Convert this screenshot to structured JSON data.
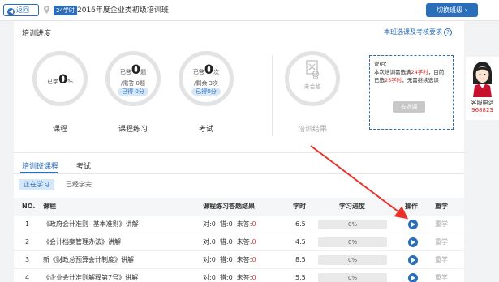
{
  "topbar": {
    "back_label": "返回",
    "hours_badge": "24学时",
    "class_title": "2016年度企业类初级培训班",
    "switch_label": "切换班级"
  },
  "progress": {
    "title": "培训进度",
    "rule_link": "本班选课及考核要求",
    "course": {
      "label": "课程",
      "prefix": "已学",
      "value": "0",
      "unit": "%"
    },
    "practice": {
      "label": "课程练习",
      "prefix": "已答",
      "value": "0",
      "unit": "题",
      "line2": "/需答 0题",
      "pill": "已得 0分"
    },
    "exam": {
      "label": "考试",
      "prefix": "已答",
      "value": "0",
      "unit": "次",
      "line2": "/剩余 3次",
      "pill": "已得0分"
    },
    "result": {
      "label": "培训结果",
      "status": "未合格"
    },
    "note": {
      "title": "说明：",
      "line1_a": "本次培训需选满",
      "line1_b": "24学时",
      "line1_c": "，目前",
      "line2_a": "已选",
      "line2_b": "25学时",
      "line2_c": "，无需继续选课",
      "button": "去选课"
    }
  },
  "tabs": [
    {
      "label": "培训班课程",
      "active": true
    },
    {
      "label": "考试",
      "active": false
    }
  ],
  "subtabs": [
    {
      "label": "正在学习",
      "active": true
    },
    {
      "label": "已经学完",
      "active": false
    }
  ],
  "table": {
    "headers": {
      "no": "NO.",
      "course": "课程",
      "practice": "课程练习答题结果",
      "hours": "学时",
      "progress": "学习进度",
      "action": "操作",
      "restudy": "重学"
    },
    "rows": [
      {
        "no": "1",
        "course": "《政府会计准则--基本准则》讲解",
        "r1": "对:0",
        "r2": "错:0",
        "r3": "未答:",
        "r3v": "0",
        "hours": "6.5",
        "progress": "0%",
        "restudy": "重学"
      },
      {
        "no": "2",
        "course": "《会计档案管理办法》讲解",
        "r1": "对:0",
        "r2": "错:0",
        "r3": "未答:",
        "r3v": "0",
        "hours": "4.5",
        "progress": "0%",
        "restudy": "重学"
      },
      {
        "no": "3",
        "course": "新《财政总预算会计制度》讲解",
        "r1": "对:0",
        "r2": "错:0",
        "r3": "未答:",
        "r3v": "0",
        "hours": "8.5",
        "progress": "0%",
        "restudy": "重学"
      },
      {
        "no": "4",
        "course": "《企业会计准则解释第7号》讲解",
        "r1": "对:0",
        "r2": "错:0",
        "r3": "未答:",
        "r3v": "0",
        "hours": "5.5",
        "progress": "0%",
        "restudy": "重学"
      }
    ]
  },
  "side": {
    "label": "客服电话",
    "phone": "968823"
  },
  "colors": {
    "accent": "#2a6db9",
    "alert": "#e23a3a",
    "arrow": "#e8322b"
  }
}
